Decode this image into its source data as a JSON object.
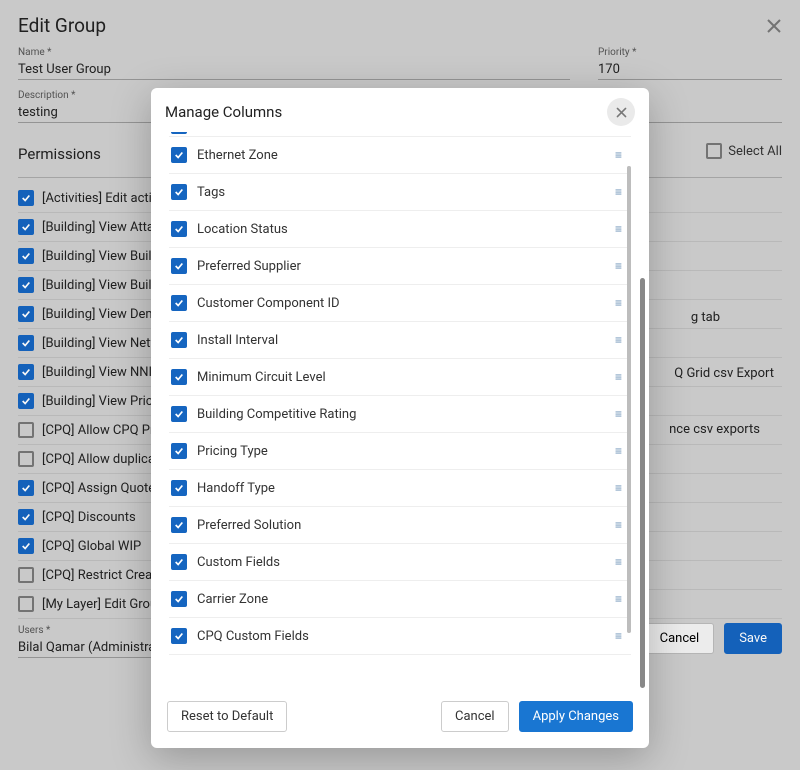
{
  "page": {
    "title": "Edit Group",
    "name_label": "Name *",
    "name_value": "Test User Group",
    "priority_label": "Priority *",
    "priority_value": "170",
    "desc_label": "Description *",
    "desc_value": "testing",
    "permissions_label": "Permissions",
    "select_all_label": "Select All",
    "users_label": "Users *",
    "users_value": "Bilal Qamar (Administrator) ,",
    "cancel": "Cancel",
    "save": "Save"
  },
  "modal": {
    "title": "Manage Columns",
    "reset": "Reset to Default",
    "cancel": "Cancel",
    "apply": "Apply Changes",
    "columns": [
      {
        "label": "Ethernet Zone",
        "checked": true
      },
      {
        "label": "Tags",
        "checked": true
      },
      {
        "label": "Location Status",
        "checked": true
      },
      {
        "label": "Preferred Supplier",
        "checked": true
      },
      {
        "label": "Customer Component ID",
        "checked": true
      },
      {
        "label": "Install Interval",
        "checked": true
      },
      {
        "label": "Minimum Circuit Level",
        "checked": true
      },
      {
        "label": "Building Competitive Rating",
        "checked": true
      },
      {
        "label": "Pricing Type",
        "checked": true
      },
      {
        "label": "Handoff Type",
        "checked": true
      },
      {
        "label": "Preferred Solution",
        "checked": true
      },
      {
        "label": "Custom Fields",
        "checked": true
      },
      {
        "label": "Carrier Zone",
        "checked": true
      },
      {
        "label": "CPQ Custom Fields",
        "checked": true
      }
    ]
  },
  "permissions": [
    {
      "l": "[Activities] Edit activity",
      "c": true
    },
    {
      "l": "[Building] View Attachm",
      "c": true
    },
    {
      "l": "[Building] View Building",
      "c": true
    },
    {
      "l": "[Building] View Building",
      "c": true
    },
    {
      "l": "[Building] View Demarc",
      "c": true
    },
    {
      "l": "[Building] View Network",
      "c": true
    },
    {
      "l": "[Building] View NNI Loc",
      "c": true
    },
    {
      "l": "[Building] View Pricing",
      "c": true
    },
    {
      "l": "[CPQ] Allow CPQ Pricin",
      "c": false
    },
    {
      "l": "[CPQ] Allow duplicates i",
      "c": false
    },
    {
      "l": "[CPQ] Assign Quotes to",
      "c": true
    },
    {
      "l": "[CPQ] Discounts",
      "c": true
    },
    {
      "l": "[CPQ] Global WIP",
      "c": true
    },
    {
      "l": "[CPQ] Restrict Create/E",
      "c": false
    },
    {
      "l": "[My Layer] Edit Group l",
      "c": false
    }
  ],
  "right_fragments": {
    "a": "g tab",
    "b": "Q Grid csv Export",
    "c": "nce csv exports"
  }
}
